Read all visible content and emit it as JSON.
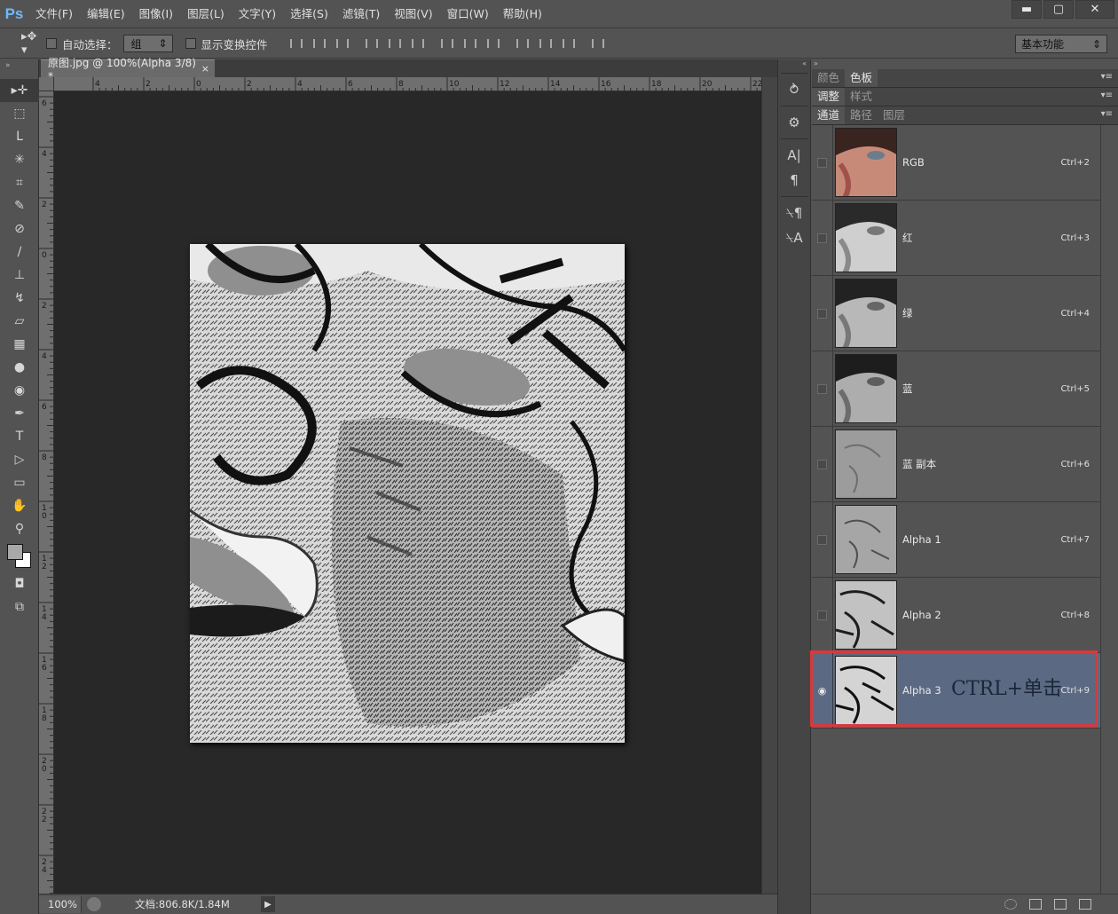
{
  "app_logo": "Ps",
  "menu": [
    "文件(F)",
    "编辑(E)",
    "图像(I)",
    "图层(L)",
    "文字(Y)",
    "选择(S)",
    "滤镜(T)",
    "视图(V)",
    "窗口(W)",
    "帮助(H)"
  ],
  "window_controls": {
    "minimize": "▬",
    "maximize": "▢",
    "close": "✕"
  },
  "options": {
    "auto_select_label": "自动选择：",
    "auto_select_value": "组",
    "show_transform_label": "显示变换控件",
    "workspace": "基本功能"
  },
  "document": {
    "tab_title": "原图.jpg @ 100%(Alpha 3/8) *",
    "tab_close": "×",
    "ruler_top_labels": [
      "4",
      "2",
      "0",
      "2",
      "4",
      "6",
      "8",
      "10",
      "12",
      "14",
      "16",
      "18",
      "20",
      "22"
    ],
    "ruler_left_labels": [
      "6",
      "4",
      "2",
      "0",
      "2",
      "4",
      "6",
      "8",
      "10",
      "12",
      "14",
      "16",
      "18",
      "20",
      "22",
      "24"
    ]
  },
  "status": {
    "zoom": "100%",
    "doc_size": "文档:806.8K/1.84M",
    "arrow": "▶"
  },
  "panel_groups": [
    {
      "tabs": [
        "颜色",
        "色板"
      ],
      "active": 1
    },
    {
      "tabs": [
        "调整",
        "样式"
      ],
      "active": 0
    },
    {
      "tabs": [
        "通道",
        "路径",
        "图层"
      ],
      "active": 0
    }
  ],
  "channels": [
    {
      "name": "RGB",
      "shortcut": "Ctrl+2",
      "visible": false,
      "thumb": "color"
    },
    {
      "name": "红",
      "shortcut": "Ctrl+3",
      "visible": false,
      "thumb": "gray"
    },
    {
      "name": "绿",
      "shortcut": "Ctrl+4",
      "visible": false,
      "thumb": "gray"
    },
    {
      "name": "蓝",
      "shortcut": "Ctrl+5",
      "visible": false,
      "thumb": "gray"
    },
    {
      "name": "蓝 副本",
      "shortcut": "Ctrl+6",
      "visible": false,
      "thumb": "light"
    },
    {
      "name": "Alpha 1",
      "shortcut": "Ctrl+7",
      "visible": false,
      "thumb": "light"
    },
    {
      "name": "Alpha 2",
      "shortcut": "Ctrl+8",
      "visible": false,
      "thumb": "contrast"
    },
    {
      "name": "Alpha 3",
      "shortcut": "Ctrl+9",
      "visible": true,
      "thumb": "contrast",
      "selected": true
    }
  ],
  "annotation": {
    "text": "CTRL+单击",
    "color": "#d8393b"
  },
  "colors": {
    "accent_selected_row": "#5b6a82",
    "ps_blue": "#6fb8ff"
  },
  "icons": [
    "move-tool-icon",
    "marquee-icon",
    "lasso-icon",
    "magic-wand-icon",
    "crop-icon",
    "eyedropper-icon",
    "healing-icon",
    "brush-icon",
    "stamp-icon",
    "history-brush-icon",
    "eraser-icon",
    "gradient-icon",
    "blur-icon",
    "dodge-icon",
    "pen-icon",
    "type-icon",
    "path-select-icon",
    "shape-icon",
    "hand-icon",
    "zoom-icon"
  ]
}
